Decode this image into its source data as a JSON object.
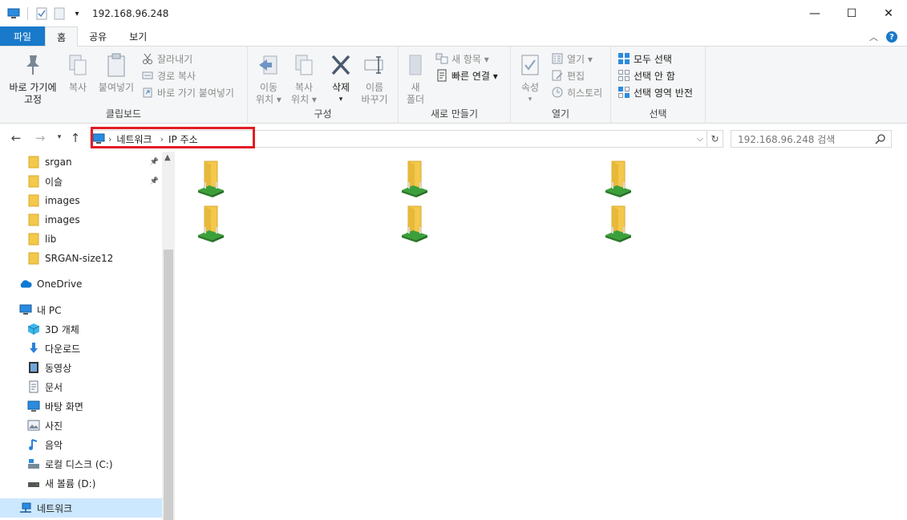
{
  "window": {
    "title": "192.168.96.248",
    "minimize_glyph": "—",
    "maximize_glyph": "☐",
    "close_glyph": "✕"
  },
  "tabs": {
    "file": "파일",
    "home": "홈",
    "share": "공유",
    "view": "보기"
  },
  "ribbon": {
    "clipboard": {
      "label": "클립보드",
      "pin_to_quick_access": "바로 가기에\n고정",
      "copy": "복사",
      "paste": "붙여넣기",
      "cut": "잘라내기",
      "copy_path": "경로 복사",
      "paste_shortcut": "바로 가기 붙여넣기"
    },
    "organize": {
      "label": "구성",
      "move_to": "이동\n위치 ▾",
      "copy_to": "복사\n위치 ▾",
      "delete": "삭제",
      "delete_arrow": "▾",
      "rename": "이름\n바꾸기"
    },
    "new": {
      "label": "새로 만들기",
      "new_folder": "새\n폴더",
      "new_item": "새 항목 ▾",
      "easy_access": "빠른 연결 ▾"
    },
    "open": {
      "label": "열기",
      "properties": "속성",
      "properties_arrow": "▾",
      "open": "열기 ▾",
      "edit": "편집",
      "history": "히스토리"
    },
    "select": {
      "label": "선택",
      "select_all": "모두 선택",
      "select_none": "선택 안 함",
      "invert_selection": "선택 영역 반전"
    }
  },
  "address": {
    "crumbs": [
      "네트워크",
      "IP 주소"
    ],
    "separator": "›",
    "search_placeholder": "192.168.96.248 검색"
  },
  "nav": {
    "quick_access": [
      {
        "label": "srgan",
        "pinned": true
      },
      {
        "label": "이슬",
        "pinned": true
      },
      {
        "label": "images",
        "pinned": false
      },
      {
        "label": "images",
        "pinned": false
      },
      {
        "label": "lib",
        "pinned": false
      },
      {
        "label": "SRGAN-size12",
        "pinned": false
      }
    ],
    "onedrive": "OneDrive",
    "this_pc": "내 PC",
    "pc_items": [
      {
        "label": "3D 개체",
        "icon": "cube-3d-icon"
      },
      {
        "label": "다운로드",
        "icon": "download-icon"
      },
      {
        "label": "동영상",
        "icon": "video-icon"
      },
      {
        "label": "문서",
        "icon": "document-icon"
      },
      {
        "label": "바탕 화면",
        "icon": "desktop-icon"
      },
      {
        "label": "사진",
        "icon": "picture-icon"
      },
      {
        "label": "음악",
        "icon": "music-icon"
      },
      {
        "label": "로컬 디스크 (C:)",
        "icon": "local-disk-icon"
      },
      {
        "label": "새 볼륨 (D:)",
        "icon": "volume-icon"
      }
    ],
    "network": "네트워크"
  },
  "content": {
    "shared_folder_count": 6
  },
  "colors": {
    "accent": "#1979ca",
    "highlight_box": "#e21d24",
    "folder": "#f3c84b",
    "network_green": "#3ba03a",
    "selected_nav": "#cce8ff"
  }
}
